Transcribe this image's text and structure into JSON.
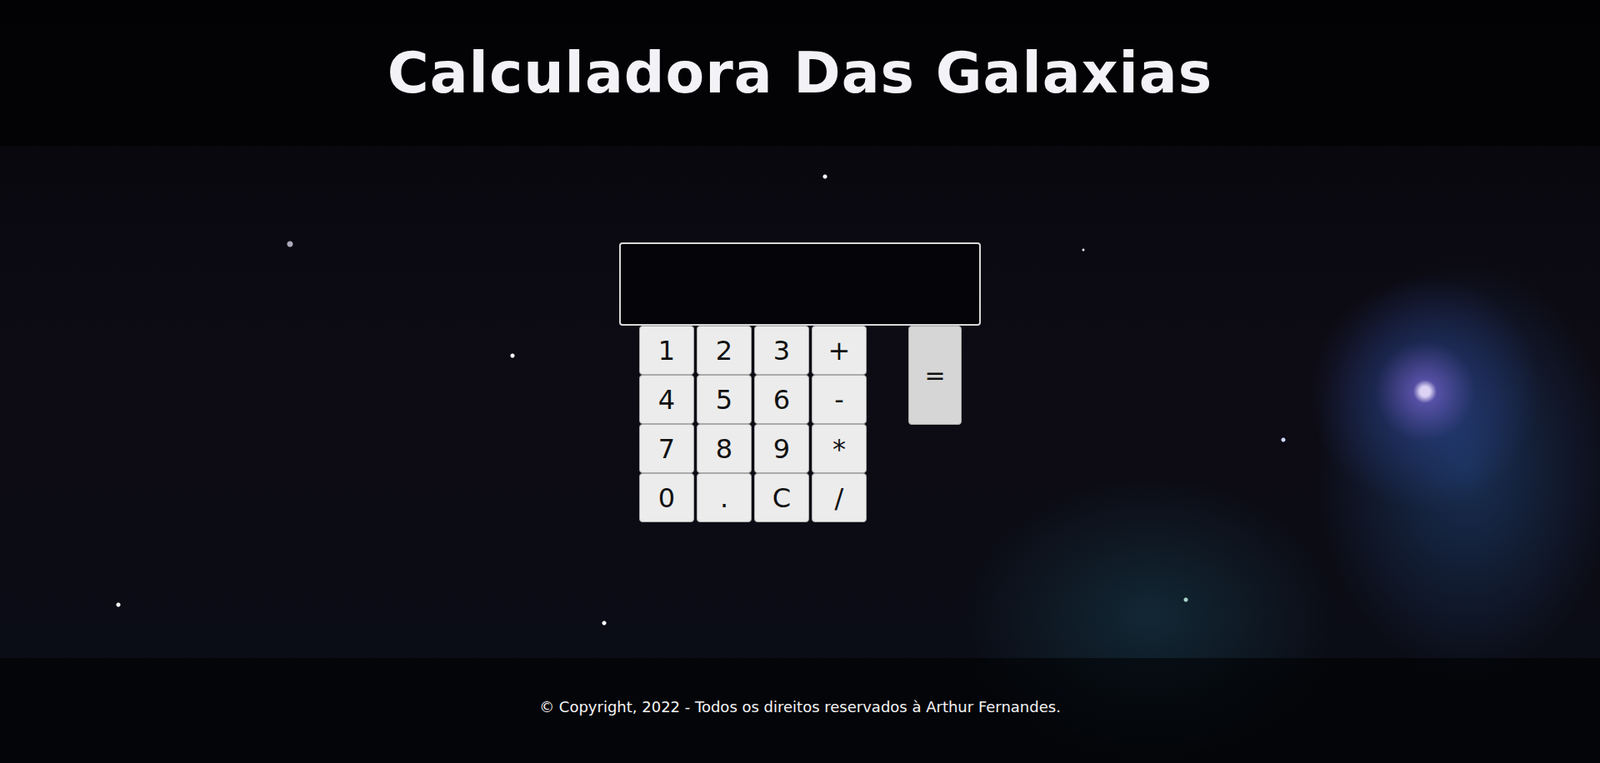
{
  "header": {
    "title": "Calculadora Das Galaxias"
  },
  "calculator": {
    "keys": [
      [
        "1",
        "2",
        "3",
        "+"
      ],
      [
        "4",
        "5",
        "6",
        "-"
      ],
      [
        "7",
        "8",
        "9",
        "*"
      ],
      [
        "0",
        ".",
        "C",
        "/"
      ]
    ],
    "equals": "="
  },
  "footer": {
    "text": "© Copyright, 2022 - Todos os direitos reservados à Arthur Fernandes."
  }
}
